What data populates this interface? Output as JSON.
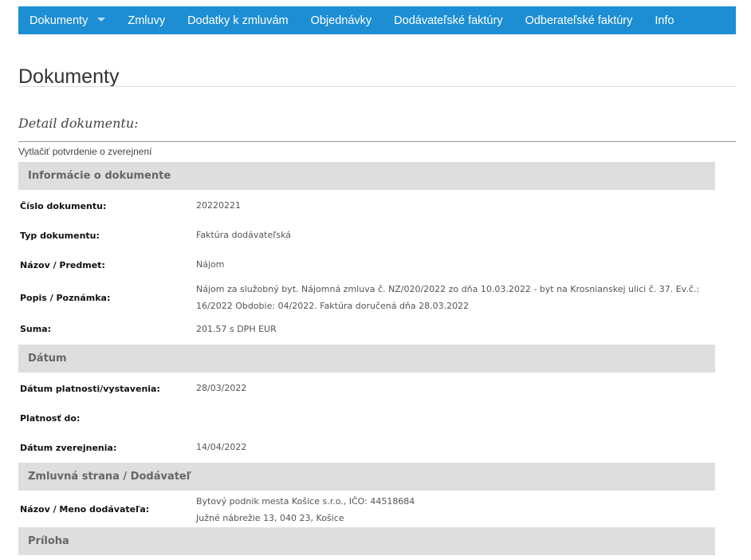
{
  "nav": {
    "items": [
      {
        "label": "Dokumenty"
      },
      {
        "label": "Zmluvy"
      },
      {
        "label": "Dodatky k zmluvám"
      },
      {
        "label": "Objednávky"
      },
      {
        "label": "Dodávateľské faktúry"
      },
      {
        "label": "Odberateľské faktúry"
      },
      {
        "label": "Info"
      }
    ]
  },
  "page": {
    "title": "Dokumenty",
    "subtitle": "Detail dokumentu:",
    "print_link": "Vytlačiť potvrdenie o zverejnení"
  },
  "sections": {
    "info": {
      "title": "Informácie o dokumente",
      "rows": [
        {
          "label": "Číslo dokumentu:",
          "value": "20220221"
        },
        {
          "label": "Typ dokumentu:",
          "value": "Faktúra dodávateľská"
        },
        {
          "label": "Názov / Predmet:",
          "value": "Nájom"
        },
        {
          "label": "Popis / Poznámka:",
          "value": "Nájom za služobný byt. Nájomná zmluva č. NZ/020/2022 zo dňa 10.03.2022 - byt na Krosnianskej ulici č. 37. Ev.č.: 16/2022 Obdobie: 04/2022. Faktúra doručená dňa 28.03.2022"
        },
        {
          "label": "Suma:",
          "value": "201.57 s DPH EUR"
        }
      ]
    },
    "datum": {
      "title": "Dátum",
      "rows": [
        {
          "label": "Dátum platnosti/vystavenia:",
          "value": "28/03/2022"
        },
        {
          "label": "Platnosť do:",
          "value": ""
        },
        {
          "label": "Dátum zverejnenia:",
          "value": "14/04/2022"
        }
      ]
    },
    "strana": {
      "title": "Zmluvná strana / Dodávateľ",
      "rows": [
        {
          "label": "Názov / Meno dodávateľa:",
          "value_line1": "Bytový podnik mesta Košice s.r.o., IČO: 44518684",
          "value_line2": "Južné nábrežie 13, 040 23, Košice"
        }
      ]
    },
    "priloha": {
      "title": "Príloha"
    }
  },
  "colors": {
    "nav_bg": "#1d8ed3",
    "section_bg": "#dedede"
  }
}
